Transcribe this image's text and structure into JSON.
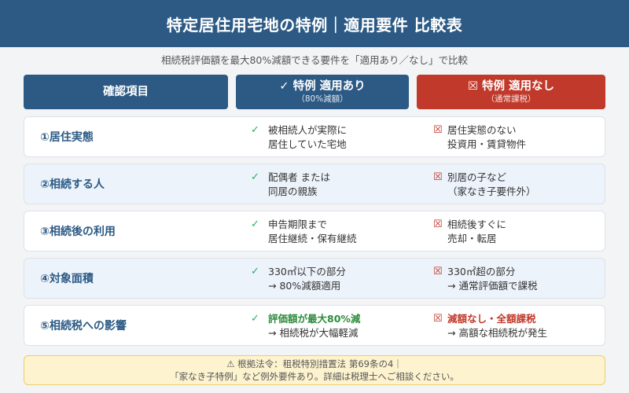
{
  "header": {
    "title": "特定居住用宅地の特例｜適用要件 比較表"
  },
  "subtitle": "相続税評価額を最大80%減額できる要件を「適用あり／なし」で比較",
  "columns": {
    "item": {
      "label": "確認項目"
    },
    "yes": {
      "label": "✓ 特例 適用あり",
      "sub": "（80%減額）"
    },
    "no": {
      "label": "☒ 特例 適用なし",
      "sub": "（通常課税）"
    }
  },
  "marks": {
    "yes": "✓",
    "no": "☒"
  },
  "rows": [
    {
      "item": "①居住実態",
      "yes": [
        "被相続人が実際に",
        "居住していた宅地"
      ],
      "no": [
        "居住実態のない",
        "投資用・賃貸物件"
      ]
    },
    {
      "item": "②相続する人",
      "yes": [
        "配偶者 または",
        "同居の親族"
      ],
      "no": [
        "別居の子など",
        "（家なき子要件外）"
      ]
    },
    {
      "item": "③相続後の利用",
      "yes": [
        "申告期限まで",
        "居住継続・保有継続"
      ],
      "no": [
        "相続後すぐに",
        "売却・転居"
      ]
    },
    {
      "item": "④対象面積",
      "yes": [
        "330㎡以下の部分",
        "→ 80%減額適用"
      ],
      "no": [
        "330㎡超の部分",
        "→ 通常評価額で課税"
      ]
    },
    {
      "item": "⑤相続税への影響",
      "yes": [
        "評価額が最大80%減",
        "→ 相続税が大幅軽減"
      ],
      "no": [
        "減額なし・全額課税",
        "→ 高額な相続税が発生"
      ]
    }
  ],
  "footer": {
    "line1": "⚠ 根拠法令：租税特別措置法 第69条の4｜",
    "line2": "「家なき子特例」など例外要件あり。詳細は税理士へご相談ください。"
  },
  "colors": {
    "header": "#2c5a85",
    "yes_accent": "#27ae60",
    "no_accent": "#c0392b",
    "footer_bg": "#fdf3cf"
  }
}
